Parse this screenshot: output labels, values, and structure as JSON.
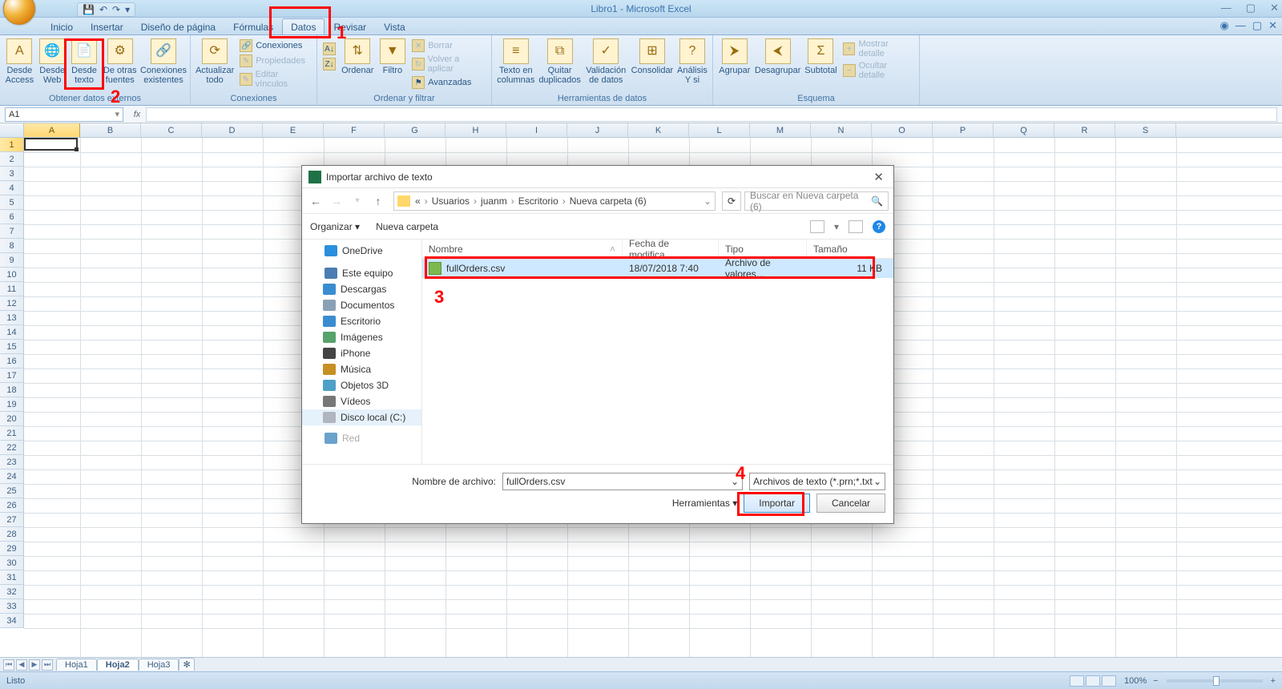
{
  "window": {
    "title": "Libro1 - Microsoft Excel"
  },
  "qat": {
    "save": "💾",
    "undo": "↶",
    "redo": "↷",
    "more": "▾"
  },
  "tabs": {
    "items": [
      {
        "label": "Inicio"
      },
      {
        "label": "Insertar"
      },
      {
        "label": "Diseño de página"
      },
      {
        "label": "Fórmulas"
      },
      {
        "label": "Datos"
      },
      {
        "label": "Revisar"
      },
      {
        "label": "Vista"
      }
    ],
    "active_index": 4
  },
  "ribbon": {
    "groups": {
      "obtener": {
        "title": "Obtener datos externos",
        "access": "Desde Access",
        "web": "Desde Web",
        "texto": "Desde texto",
        "otras": "De otras fuentes",
        "existentes": "Conexiones existentes"
      },
      "conex": {
        "title": "Conexiones",
        "actualizar": "Actualizar todo",
        "conexiones": "Conexiones",
        "propiedades": "Propiedades",
        "editar": "Editar vínculos"
      },
      "ordenar": {
        "title": "Ordenar y filtrar",
        "az": "A↓Z",
        "za": "Z↓A",
        "ordenar": "Ordenar",
        "filtro": "Filtro",
        "borrar": "Borrar",
        "volver": "Volver a aplicar",
        "avanzadas": "Avanzadas"
      },
      "herr": {
        "title": "Herramientas de datos",
        "texto_col": "Texto en columnas",
        "quitar": "Quitar duplicados",
        "valid": "Validación de datos",
        "consol": "Consolidar",
        "analisis": "Análisis Y si"
      },
      "esquema": {
        "title": "Esquema",
        "agrupar": "Agrupar",
        "desagrupar": "Desagrupar",
        "subtotal": "Subtotal",
        "mostrar": "Mostrar detalle",
        "ocultar": "Ocultar detalle"
      }
    }
  },
  "namebox": {
    "value": "A1",
    "fx": "fx"
  },
  "columns": [
    "A",
    "B",
    "C",
    "D",
    "E",
    "F",
    "G",
    "H",
    "I",
    "J",
    "K",
    "L",
    "M",
    "N",
    "O",
    "P",
    "Q",
    "R",
    "S"
  ],
  "sheet_tabs": {
    "items": [
      "Hoja1",
      "Hoja2",
      "Hoja3"
    ],
    "active_index": 1
  },
  "statusbar": {
    "ready": "Listo",
    "zoom": "100%",
    "minus": "−",
    "plus": "+"
  },
  "dialog": {
    "title": "Importar archivo de texto",
    "breadcrumb": {
      "p0": "«",
      "p1": "Usuarios",
      "p2": "juanm",
      "p3": "Escritorio",
      "p4": "Nueva carpeta (6)"
    },
    "search_placeholder": "Buscar en Nueva carpeta (6)",
    "toolbar": {
      "organizar": "Organizar",
      "nueva": "Nueva carpeta"
    },
    "nav": {
      "onedrive": "OneDrive",
      "equipo": "Este equipo",
      "descargas": "Descargas",
      "documentos": "Documentos",
      "escritorio": "Escritorio",
      "imagenes": "Imágenes",
      "iphone": "iPhone",
      "musica": "Música",
      "objetos": "Objetos 3D",
      "videos": "Vídeos",
      "disco": "Disco local (C:)",
      "red": "Red"
    },
    "headers": {
      "nombre": "Nombre",
      "fecha": "Fecha de modifica...",
      "tipo": "Tipo",
      "tam": "Tamaño"
    },
    "file": {
      "name": "fullOrders.csv",
      "date": "18/07/2018 7:40",
      "type": "Archivo de valores...",
      "size": "11 KB"
    },
    "foot": {
      "nombre_label": "Nombre de archivo:",
      "nombre_value": "fullOrders.csv",
      "filter": "Archivos de texto (*.prn;*.txt;*.c",
      "herramientas": "Herramientas",
      "importar": "Importar",
      "cancelar": "Cancelar"
    }
  },
  "annotations": {
    "n1": "1",
    "n2": "2",
    "n3": "3",
    "n4": "4"
  }
}
